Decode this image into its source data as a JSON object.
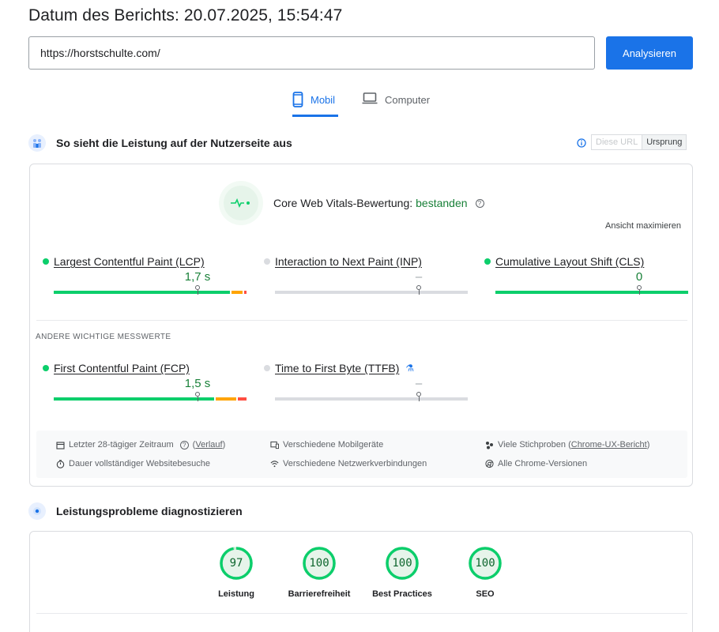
{
  "report": {
    "date_label": "Datum des Berichts: 20.07.2025, 15:54:47"
  },
  "search": {
    "url_value": "https://horstschulte.com/",
    "analyze_label": "Analysieren"
  },
  "tabs": [
    {
      "label": "Mobil",
      "icon": "smartphone-icon",
      "active": true
    },
    {
      "label": "Computer",
      "icon": "laptop-icon",
      "active": false
    }
  ],
  "field_section": {
    "title": "So sieht die Leistung auf der Nutzerseite aus",
    "toggle": {
      "this_url": "Diese URL",
      "origin": "Ursprung",
      "selected": "origin"
    },
    "cwv": {
      "label": "Core Web Vitals-Bewertung:",
      "status": "bestanden",
      "expand": "Ansicht maximieren"
    },
    "core_metrics": [
      {
        "name": "Largest Contentful Paint (LCP)",
        "value": "1,7 s",
        "status": "good"
      },
      {
        "name": "Interaction to Next Paint (INP)",
        "value": "–",
        "status": "none"
      },
      {
        "name": "Cumulative Layout Shift (CLS)",
        "value": "0",
        "status": "good"
      }
    ],
    "other_label": "ANDERE WICHTIGE MESSWERTE",
    "other_metrics": [
      {
        "name": "First Contentful Paint (FCP)",
        "value": "1,5 s",
        "status": "good"
      },
      {
        "name": "Time to First Byte (TTFB)",
        "value": "–",
        "status": "none"
      }
    ],
    "meta": {
      "period": "Letzter 28-tägiger Zeitraum",
      "history_link": "Verlauf",
      "full_visits": "Dauer vollständiger Websitebesuche",
      "devices": "Verschiedene Mobilgeräte",
      "networks": "Verschiedene Netzwerkverbindungen",
      "samples_prefix": "Viele Stichproben (",
      "samples_link": "Chrome-UX-Bericht",
      "samples_suffix": ")",
      "versions": "Alle Chrome-Versionen"
    }
  },
  "diagnose_section": {
    "title": "Leistungsprobleme diagnostizieren",
    "scores": [
      {
        "label": "Leistung",
        "value": "97",
        "score": 97
      },
      {
        "label": "Barrierefreiheit",
        "value": "100",
        "score": 100
      },
      {
        "label": "Best Practices",
        "value": "100",
        "score": 100
      },
      {
        "label": "SEO",
        "value": "100",
        "score": 100
      }
    ]
  },
  "colors": {
    "accent": "#1a73e8",
    "good": "#0cce6b",
    "good_text": "#188038",
    "average": "#ffa400",
    "poor": "#ff4e42"
  }
}
